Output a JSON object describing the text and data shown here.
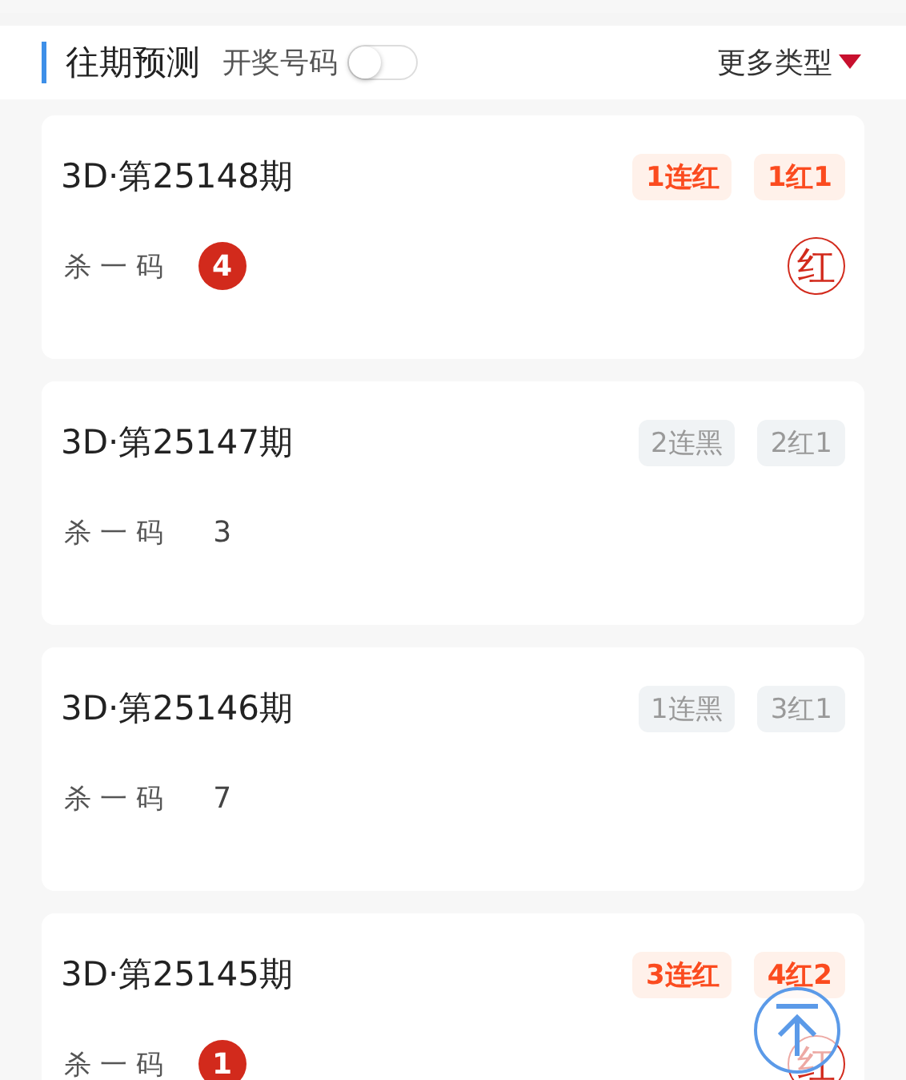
{
  "header": {
    "title": "往期预测",
    "toggle": {
      "label": "开奖号码",
      "on": false
    },
    "more": {
      "label": "更多类型"
    }
  },
  "records": [
    {
      "issue": "3D·第25148期",
      "tags": [
        "1连红",
        "1红1"
      ],
      "label": "杀 一 码",
      "number": "4",
      "hit": true,
      "result": "红"
    },
    {
      "issue": "3D·第25147期",
      "tags": [
        "2连黑",
        "2红1"
      ],
      "label": "杀 一 码",
      "number": "3",
      "hit": false
    },
    {
      "issue": "3D·第25146期",
      "tags": [
        "1连黑",
        "3红1"
      ],
      "label": "杀 一 码",
      "number": "7",
      "hit": false
    },
    {
      "issue": "3D·第25145期",
      "tags": [
        "3连红",
        "4红2"
      ],
      "label": "杀 一 码",
      "number": "1",
      "hit": true,
      "result": "红"
    }
  ]
}
